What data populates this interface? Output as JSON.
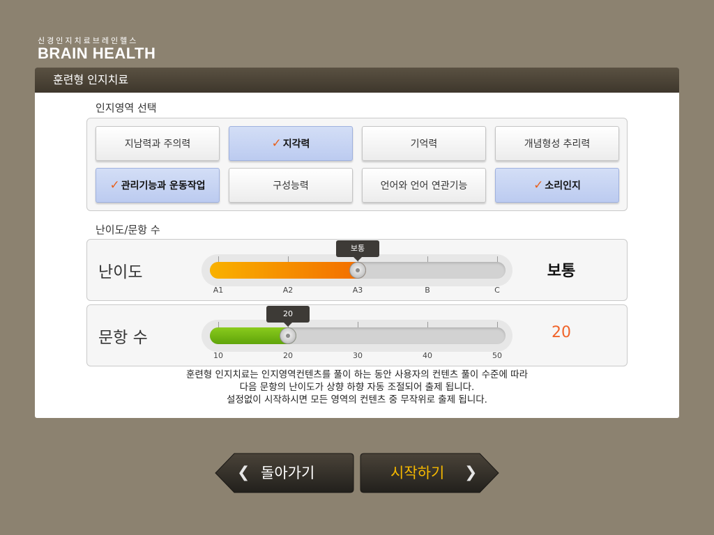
{
  "logo": {
    "subtitle": "신경인지치료브레인헬스",
    "title": "BRAIN HEALTH"
  },
  "panel": {
    "title": "훈련형 인지치료"
  },
  "areas": {
    "title": "인지영역 선택",
    "items": [
      {
        "label": "지남력과 주의력",
        "selected": false
      },
      {
        "label": "지각력",
        "selected": true
      },
      {
        "label": "기억력",
        "selected": false
      },
      {
        "label": "개념형성 추리력",
        "selected": false
      },
      {
        "label": "관리기능과 운동작업",
        "selected": true
      },
      {
        "label": "구성능력",
        "selected": false
      },
      {
        "label": "언어와 언어 연관기능",
        "selected": false
      },
      {
        "label": "소리인지",
        "selected": true
      }
    ],
    "check_mark": "✓"
  },
  "settings": {
    "title": "난이도/문항 수",
    "difficulty": {
      "label": "난이도",
      "ticks": [
        "A1",
        "A2",
        "A3",
        "B",
        "C"
      ],
      "selected_index": 2,
      "bubble": "보통",
      "value": "보통"
    },
    "questions": {
      "label": "문항 수",
      "ticks": [
        "10",
        "20",
        "30",
        "40",
        "50"
      ],
      "selected_index": 1,
      "bubble": "20",
      "value": "20"
    }
  },
  "description": {
    "line1": "훈련형 인지치료는 인지영역컨텐츠를 풀이 하는 동안  사용자의 컨텐츠 풀이 수준에 따라",
    "line2": "다음 문항의 난이도가  상향 하향  자동 조절되어 출제 됩니다.",
    "line3": "설정없이 시작하시면 모든 영역의 컨텐츠 중 무작위로 출제 됩니다."
  },
  "buttons": {
    "back": "돌아가기",
    "start": "시작하기",
    "back_icon": "chevron-left-icon",
    "start_icon": "chevron-right-icon"
  },
  "colors": {
    "background": "#8c8270",
    "header": "#4a4336",
    "selected": "#c7d4f2",
    "check": "#e8601c",
    "difficulty_fill": "#f26b00",
    "questions_fill": "#6fb314",
    "start_text": "#f5b800",
    "value_orange": "#f0642a"
  }
}
